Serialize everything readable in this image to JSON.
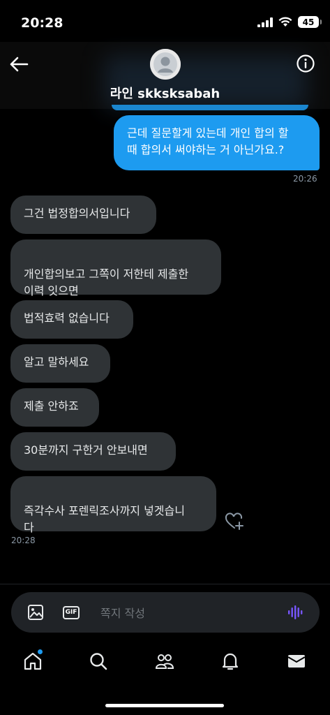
{
  "status_bar": {
    "time": "20:28",
    "battery": "45"
  },
  "header": {
    "name": "라인 skksksabah"
  },
  "messages": [
    {
      "dir": "out",
      "text": "근데 질문할게 있는데 개인 합의 할\n때 합의서 써야하는 거 아닌가요.?"
    },
    {
      "dir": "in",
      "text": "그건 법정합의서입니다"
    },
    {
      "dir": "in",
      "text": "개인합의보고 그쪽이 저한테 제출한\n이력 잇으면"
    },
    {
      "dir": "in",
      "text": "법적효력 없습니다"
    },
    {
      "dir": "in",
      "text": "알고 말하세요"
    },
    {
      "dir": "in",
      "text": "제출 안하죠"
    },
    {
      "dir": "in",
      "text": "30분까지 구한거 안보내면"
    },
    {
      "dir": "in",
      "text": "즉각수사 포렌릭조사까지 넣겟습니\n다"
    }
  ],
  "timestamps": {
    "outgoing": "20:26",
    "incoming": "20:28"
  },
  "composer": {
    "placeholder": "쪽지 작성",
    "gif_label": "GIF"
  },
  "colors": {
    "accent": "#1d9bf0",
    "incoming_bubble": "#2f3336",
    "voice": "#7856ff"
  }
}
